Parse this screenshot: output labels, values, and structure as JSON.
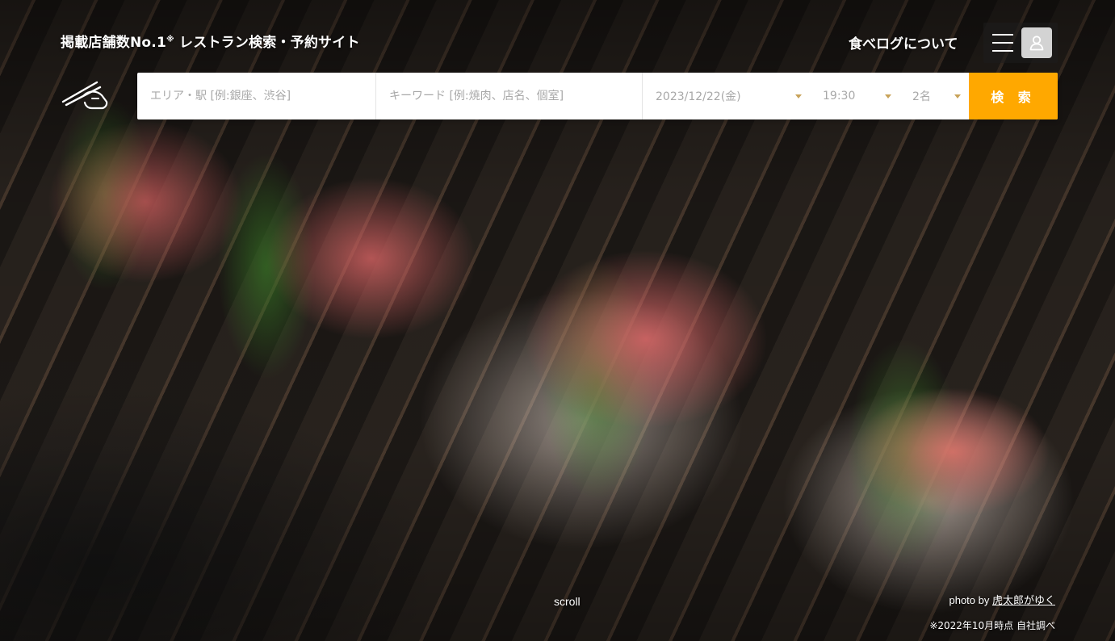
{
  "header": {
    "tagline_main": "掲載店舗数No.1",
    "tagline_mark": "※",
    "tagline_rest": " レストラン検索・予約サイト",
    "about_link": "食べログについて",
    "menu_icon": "hamburger-menu-icon",
    "user_icon": "user-icon"
  },
  "search": {
    "logo_icon": "chopsticks-hand-icon",
    "area_placeholder": "エリア・駅 [例:銀座、渋谷]",
    "keyword_placeholder": "キーワード [例:焼肉、店名、個室]",
    "date_value": "2023/12/22(金)",
    "time_value": "19:30",
    "people_value": "2名",
    "submit_label": "検 索",
    "accent_color": "#ffa800"
  },
  "footer": {
    "scroll_label": "scroll",
    "photo_prefix": "photo by ",
    "photo_author": "虎太郎がゆく",
    "note": "※2022年10月時点 自社調べ"
  }
}
